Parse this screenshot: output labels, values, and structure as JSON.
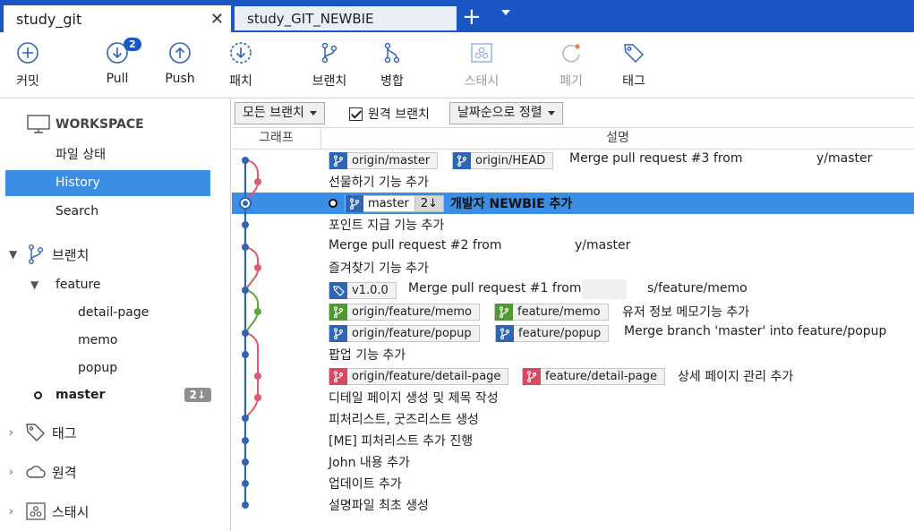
{
  "tabs": [
    {
      "label": "study_git",
      "close": "✕"
    },
    {
      "label": "study_GIT_NEWBIE"
    }
  ],
  "tab_add": "+",
  "toolbar": {
    "commit": "커밋",
    "pull": "Pull",
    "pull_badge": "2",
    "push": "Push",
    "patch": "패치",
    "branch": "브랜치",
    "merge": "병합",
    "stash": "스태시",
    "discard": "폐기",
    "tag": "태그"
  },
  "sidebar": {
    "workspace": "WORKSPACE",
    "items": [
      "파일 상태",
      "History",
      "Search"
    ],
    "branches": "브랜치",
    "feature_folder": "feature",
    "feature_branches": [
      "detail-page",
      "memo",
      "popup"
    ],
    "master": "master",
    "master_badge": "2↓",
    "tags": "태그",
    "remotes": "원격",
    "stashes": "스태시"
  },
  "filters": {
    "branches": "모든 브랜치",
    "remote": "원격 브랜치",
    "sort": "날짜순으로 정렬"
  },
  "columns": {
    "graph": "그래프",
    "desc": "설명"
  },
  "commits": [
    {
      "labels": [
        "origin/master",
        "origin/HEAD"
      ],
      "msg": "Merge pull request #3 from",
      "tail": "y/master"
    },
    {
      "msg": "선물하기 기능 추가"
    },
    {
      "head": "master",
      "head_count": "2↓",
      "msg": "개발자 NEWBIE 추가"
    },
    {
      "msg": "포인트 지급 기능 추가"
    },
    {
      "msg": "Merge pull request #2 from",
      "tail": "y/master"
    },
    {
      "msg": "즐겨찾기 기능 추가"
    },
    {
      "tag": "v1.0.0",
      "msg": "Merge pull request #1 from",
      "tail": "s/feature/memo"
    },
    {
      "labels": [
        "origin/feature/memo",
        "feature/memo"
      ],
      "msg": "유저 정보 메모기능 추가"
    },
    {
      "labels": [
        "origin/feature/popup",
        "feature/popup"
      ],
      "msg": "Merge branch 'master' into feature/popup"
    },
    {
      "msg": "팝업 기능 추가"
    },
    {
      "labels": [
        "origin/feature/detail-page",
        "feature/detail-page"
      ],
      "msg": "상세 페이지 관리 추가"
    },
    {
      "msg": "디테일 페이지 생성 및 제목 작성"
    },
    {
      "msg": "피처리스트, 굿즈리스트 생성"
    },
    {
      "msg": "[ME] 피처리스트 추가 진행"
    },
    {
      "msg": "John 내용 추가"
    },
    {
      "msg": "업데이트 추가"
    },
    {
      "msg": "설명파일 최초 생성"
    }
  ],
  "colors": {
    "accent": "#1a56c4",
    "selection": "#3a8ee6",
    "graph_blue": "#2e66b3",
    "graph_red": "#e05a6e",
    "graph_green": "#5aaa38"
  }
}
